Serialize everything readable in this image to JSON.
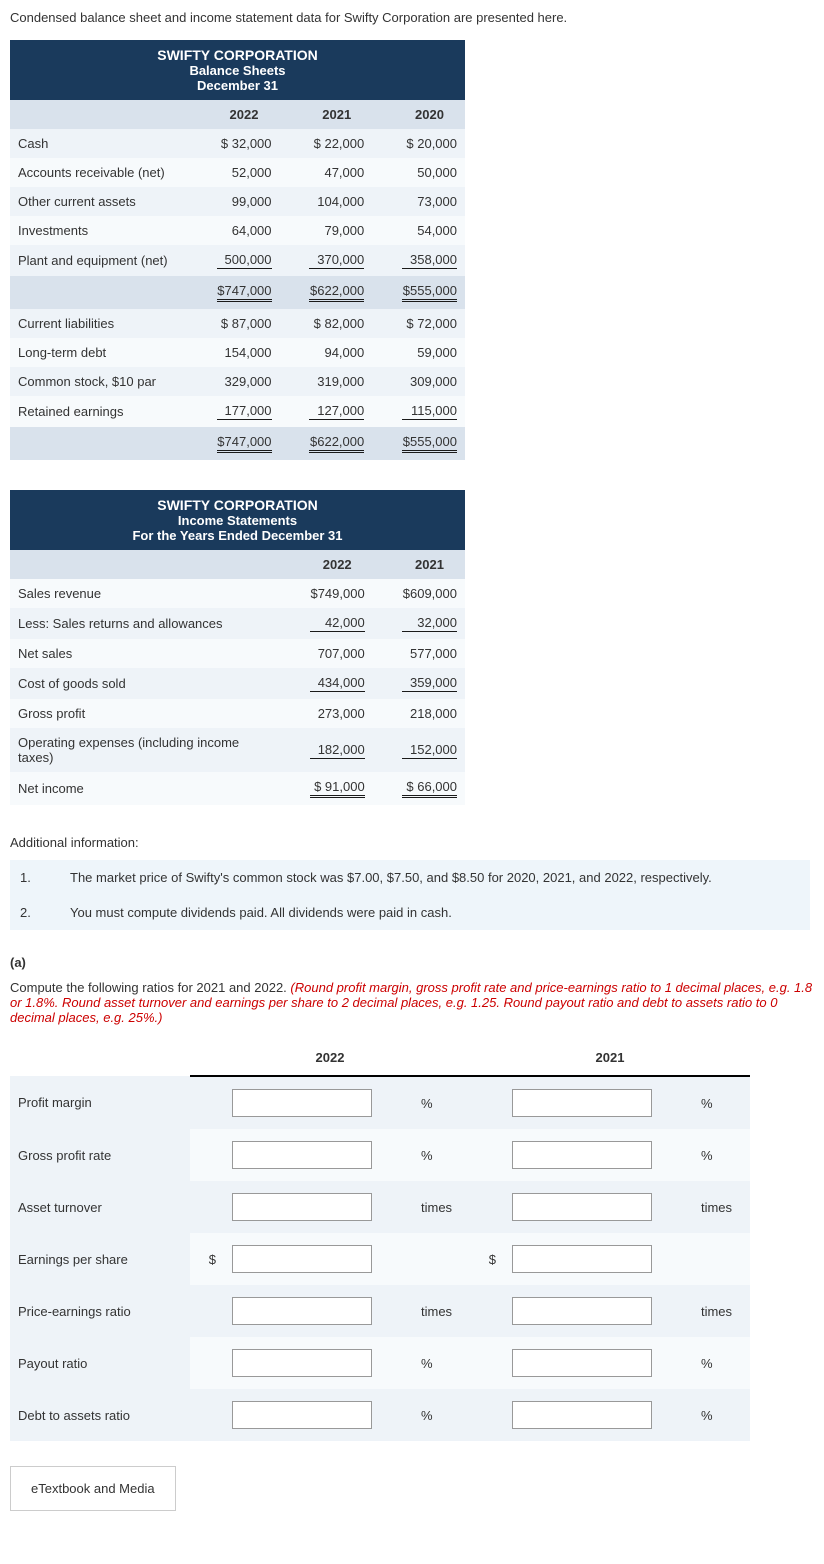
{
  "intro": "Condensed balance sheet and income statement data for Swifty Corporation are presented here.",
  "bs": {
    "title": "SWIFTY CORPORATION",
    "sub1": "Balance Sheets",
    "sub2": "December 31",
    "yrs": [
      "2022",
      "2021",
      "2020"
    ],
    "rows": [
      {
        "l": "Cash",
        "v": [
          "$ 32,000",
          "$ 22,000",
          "$ 20,000"
        ],
        "u": ""
      },
      {
        "l": "Accounts receivable (net)",
        "v": [
          "52,000",
          "47,000",
          "50,000"
        ],
        "u": ""
      },
      {
        "l": "Other current assets",
        "v": [
          "99,000",
          "104,000",
          "73,000"
        ],
        "u": ""
      },
      {
        "l": "Investments",
        "v": [
          "64,000",
          "79,000",
          "54,000"
        ],
        "u": ""
      },
      {
        "l": "Plant and equipment (net)",
        "v": [
          "500,000",
          "370,000",
          "358,000"
        ],
        "u": "s"
      }
    ],
    "tot1": [
      "$747,000",
      "$622,000",
      "$555,000"
    ],
    "rows2": [
      {
        "l": "Current liabilities",
        "v": [
          "$ 87,000",
          "$ 82,000",
          "$ 72,000"
        ],
        "u": ""
      },
      {
        "l": "Long-term debt",
        "v": [
          "154,000",
          "94,000",
          "59,000"
        ],
        "u": ""
      },
      {
        "l": "Common stock, $10 par",
        "v": [
          "329,000",
          "319,000",
          "309,000"
        ],
        "u": ""
      },
      {
        "l": "Retained earnings",
        "v": [
          "177,000",
          "127,000",
          "115,000"
        ],
        "u": "s"
      }
    ],
    "tot2": [
      "$747,000",
      "$622,000",
      "$555,000"
    ]
  },
  "is": {
    "title": "SWIFTY CORPORATION",
    "sub1": "Income Statements",
    "sub2": "For the Years Ended December 31",
    "yrs": [
      "2022",
      "2021"
    ],
    "rows": [
      {
        "l": "Sales revenue",
        "v": [
          "$749,000",
          "$609,000"
        ],
        "u": ""
      },
      {
        "l": "Less: Sales returns and allowances",
        "v": [
          "42,000",
          "32,000"
        ],
        "u": "s"
      },
      {
        "l": "Net sales",
        "v": [
          "707,000",
          "577,000"
        ],
        "u": ""
      },
      {
        "l": "Cost of goods sold",
        "v": [
          "434,000",
          "359,000"
        ],
        "u": "s"
      },
      {
        "l": "Gross profit",
        "v": [
          "273,000",
          "218,000"
        ],
        "u": ""
      },
      {
        "l": "Operating expenses (including income taxes)",
        "v": [
          "182,000",
          "152,000"
        ],
        "u": "s"
      },
      {
        "l": "Net income",
        "v": [
          "$ 91,000",
          "$ 66,000"
        ],
        "u": "d"
      }
    ]
  },
  "addl_label": "Additional information:",
  "info": [
    {
      "n": "1.",
      "t": "The market price of Swifty's common stock was $7.00, $7.50, and $8.50 for 2020, 2021, and 2022, respectively."
    },
    {
      "n": "2.",
      "t": "You must compute dividends paid. All dividends were paid in cash."
    }
  ],
  "part": "(a)",
  "instr_black": "Compute the following ratios for 2021 and 2022. ",
  "instr_red": "(Round profit margin, gross profit rate and price-earnings ratio to 1 decimal places, e.g. 1.8 or 1.8%. Round asset turnover and earnings per share to 2 decimal places, e.g. 1.25. Round payout ratio and debt to assets ratio to 0 decimal places, e.g. 25%.)",
  "ratio": {
    "hdrs": [
      "2022",
      "2021"
    ],
    "rows": [
      {
        "l": "Profit margin",
        "pre": "",
        "unit": "%"
      },
      {
        "l": "Gross profit rate",
        "pre": "",
        "unit": "%"
      },
      {
        "l": "Asset turnover",
        "pre": "",
        "unit": "times"
      },
      {
        "l": "Earnings per share",
        "pre": "$",
        "unit": ""
      },
      {
        "l": "Price-earnings ratio",
        "pre": "",
        "unit": "times"
      },
      {
        "l": "Payout ratio",
        "pre": "",
        "unit": "%"
      },
      {
        "l": "Debt to assets ratio",
        "pre": "",
        "unit": "%"
      }
    ]
  },
  "etext": "eTextbook and Media"
}
